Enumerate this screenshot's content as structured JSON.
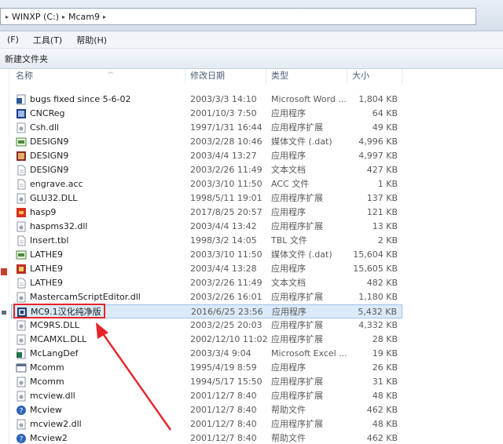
{
  "address": {
    "segments": [
      "WINXP (C:)",
      "Mcam9"
    ]
  },
  "menu": {
    "items": [
      "(F)",
      "工具(T)",
      "帮助(H)"
    ]
  },
  "toolbar": {
    "new_folder": "新建文件夹"
  },
  "columns": {
    "name": "名称",
    "date": "修改日期",
    "type": "类型",
    "size": "大小"
  },
  "files": [
    {
      "name": "bugs fixed since 5-6-02",
      "date": "2003/3/3 14:10",
      "type": "Microsoft Word ...",
      "size": "1,804 KB",
      "icon": "word-doc-icon"
    },
    {
      "name": "CNCReg",
      "date": "2001/10/3 7:50",
      "type": "应用程序",
      "size": "64 KB",
      "icon": "app-icon"
    },
    {
      "name": "Csh.dll",
      "date": "1997/1/31 16:44",
      "type": "应用程序扩展",
      "size": "49 KB",
      "icon": "dll-icon"
    },
    {
      "name": "DESIGN9",
      "date": "2003/2/28 10:46",
      "type": "媒体文件 (.dat)",
      "size": "4,996 KB",
      "icon": "media-file-icon"
    },
    {
      "name": "DESIGN9",
      "date": "2003/4/4 13:27",
      "type": "应用程序",
      "size": "4,997 KB",
      "icon": "design-app-icon"
    },
    {
      "name": "DESIGN9",
      "date": "2003/2/26 11:49",
      "type": "文本文档",
      "size": "427 KB",
      "icon": "text-doc-icon"
    },
    {
      "name": "engrave.acc",
      "date": "2003/3/10 11:50",
      "type": "ACC 文件",
      "size": "1 KB",
      "icon": "file-icon"
    },
    {
      "name": "GLU32.DLL",
      "date": "1998/5/11 19:01",
      "type": "应用程序扩展",
      "size": "137 KB",
      "icon": "dll-icon"
    },
    {
      "name": "hasp9",
      "date": "2017/8/25 20:57",
      "type": "应用程序",
      "size": "121 KB",
      "icon": "hasp-app-icon"
    },
    {
      "name": "haspms32.dll",
      "date": "2003/4/4 13:42",
      "type": "应用程序扩展",
      "size": "13 KB",
      "icon": "dll-icon"
    },
    {
      "name": "Insert.tbl",
      "date": "1998/3/2 14:05",
      "type": "TBL 文件",
      "size": "2 KB",
      "icon": "file-icon"
    },
    {
      "name": "LATHE9",
      "date": "2003/3/10 11:50",
      "type": "媒体文件 (.dat)",
      "size": "15,604 KB",
      "icon": "media-file-icon"
    },
    {
      "name": "LATHE9",
      "date": "2003/4/4 13:28",
      "type": "应用程序",
      "size": "15,605 KB",
      "icon": "lathe-app-icon"
    },
    {
      "name": "LATHE9",
      "date": "2003/2/26 11:49",
      "type": "文本文档",
      "size": "482 KB",
      "icon": "text-doc-icon"
    },
    {
      "name": "MastercamScriptEditor.dll",
      "date": "2003/2/26 16:01",
      "type": "应用程序扩展",
      "size": "1,180 KB",
      "icon": "dll-icon"
    },
    {
      "name": "MC9.1汉化纯净版",
      "date": "2016/6/25 23:56",
      "type": "应用程序",
      "size": "5,432 KB",
      "icon": "mc9-app-icon",
      "selected": true
    },
    {
      "name": "MC9RS.DLL",
      "date": "2003/2/25 20:03",
      "type": "应用程序扩展",
      "size": "4,332 KB",
      "icon": "dll-icon"
    },
    {
      "name": "MCAMXL.DLL",
      "date": "2002/12/10 11:02",
      "type": "应用程序扩展",
      "size": "28 KB",
      "icon": "dll-icon"
    },
    {
      "name": "McLangDef",
      "date": "2003/3/4 9:04",
      "type": "Microsoft Excel ...",
      "size": "19 KB",
      "icon": "excel-icon"
    },
    {
      "name": "Mcomm",
      "date": "1995/4/19 8:59",
      "type": "应用程序",
      "size": "26 KB",
      "icon": "app-window-icon"
    },
    {
      "name": "Mcomm",
      "date": "1994/5/17 15:50",
      "type": "应用程序扩展",
      "size": "31 KB",
      "icon": "dll-icon"
    },
    {
      "name": "mcview.dll",
      "date": "2001/12/7 8:40",
      "type": "应用程序扩展",
      "size": "48 KB",
      "icon": "dll-icon"
    },
    {
      "name": "Mcview",
      "date": "2001/12/7 8:40",
      "type": "帮助文件",
      "size": "462 KB",
      "icon": "help-icon"
    },
    {
      "name": "mcview2.dll",
      "date": "2001/12/7 8:40",
      "type": "应用程序扩展",
      "size": "48 KB",
      "icon": "dll-icon"
    },
    {
      "name": "Mcview2",
      "date": "2001/12/7 8:40",
      "type": "帮助文件",
      "size": "462 KB",
      "icon": "help-icon"
    }
  ],
  "colors": {
    "highlight": "#e4252b",
    "selection": "#dbeaf9",
    "header_text": "#4c607a"
  }
}
